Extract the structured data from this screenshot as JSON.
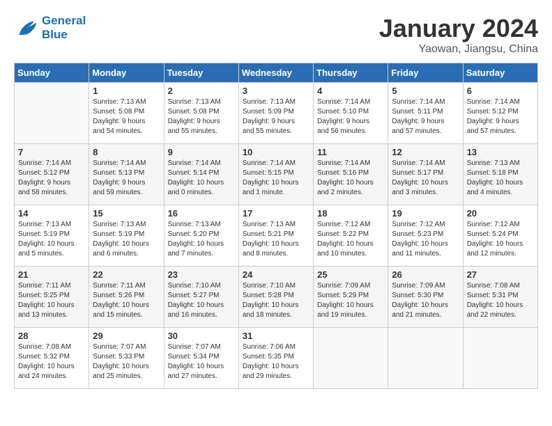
{
  "header": {
    "logo_line1": "General",
    "logo_line2": "Blue",
    "title": "January 2024",
    "subtitle": "Yaowan, Jiangsu, China"
  },
  "weekdays": [
    "Sunday",
    "Monday",
    "Tuesday",
    "Wednesday",
    "Thursday",
    "Friday",
    "Saturday"
  ],
  "weeks": [
    [
      {
        "day": "",
        "info": ""
      },
      {
        "day": "1",
        "info": "Sunrise: 7:13 AM\nSunset: 5:08 PM\nDaylight: 9 hours\nand 54 minutes."
      },
      {
        "day": "2",
        "info": "Sunrise: 7:13 AM\nSunset: 5:08 PM\nDaylight: 9 hours\nand 55 minutes."
      },
      {
        "day": "3",
        "info": "Sunrise: 7:13 AM\nSunset: 5:09 PM\nDaylight: 9 hours\nand 55 minutes."
      },
      {
        "day": "4",
        "info": "Sunrise: 7:14 AM\nSunset: 5:10 PM\nDaylight: 9 hours\nand 56 minutes."
      },
      {
        "day": "5",
        "info": "Sunrise: 7:14 AM\nSunset: 5:11 PM\nDaylight: 9 hours\nand 57 minutes."
      },
      {
        "day": "6",
        "info": "Sunrise: 7:14 AM\nSunset: 5:12 PM\nDaylight: 9 hours\nand 57 minutes."
      }
    ],
    [
      {
        "day": "7",
        "info": "Sunrise: 7:14 AM\nSunset: 5:12 PM\nDaylight: 9 hours\nand 58 minutes."
      },
      {
        "day": "8",
        "info": "Sunrise: 7:14 AM\nSunset: 5:13 PM\nDaylight: 9 hours\nand 59 minutes."
      },
      {
        "day": "9",
        "info": "Sunrise: 7:14 AM\nSunset: 5:14 PM\nDaylight: 10 hours\nand 0 minutes."
      },
      {
        "day": "10",
        "info": "Sunrise: 7:14 AM\nSunset: 5:15 PM\nDaylight: 10 hours\nand 1 minute."
      },
      {
        "day": "11",
        "info": "Sunrise: 7:14 AM\nSunset: 5:16 PM\nDaylight: 10 hours\nand 2 minutes."
      },
      {
        "day": "12",
        "info": "Sunrise: 7:14 AM\nSunset: 5:17 PM\nDaylight: 10 hours\nand 3 minutes."
      },
      {
        "day": "13",
        "info": "Sunrise: 7:13 AM\nSunset: 5:18 PM\nDaylight: 10 hours\nand 4 minutes."
      }
    ],
    [
      {
        "day": "14",
        "info": "Sunrise: 7:13 AM\nSunset: 5:19 PM\nDaylight: 10 hours\nand 5 minutes."
      },
      {
        "day": "15",
        "info": "Sunrise: 7:13 AM\nSunset: 5:19 PM\nDaylight: 10 hours\nand 6 minutes."
      },
      {
        "day": "16",
        "info": "Sunrise: 7:13 AM\nSunset: 5:20 PM\nDaylight: 10 hours\nand 7 minutes."
      },
      {
        "day": "17",
        "info": "Sunrise: 7:13 AM\nSunset: 5:21 PM\nDaylight: 10 hours\nand 8 minutes."
      },
      {
        "day": "18",
        "info": "Sunrise: 7:12 AM\nSunset: 5:22 PM\nDaylight: 10 hours\nand 10 minutes."
      },
      {
        "day": "19",
        "info": "Sunrise: 7:12 AM\nSunset: 5:23 PM\nDaylight: 10 hours\nand 11 minutes."
      },
      {
        "day": "20",
        "info": "Sunrise: 7:12 AM\nSunset: 5:24 PM\nDaylight: 10 hours\nand 12 minutes."
      }
    ],
    [
      {
        "day": "21",
        "info": "Sunrise: 7:11 AM\nSunset: 5:25 PM\nDaylight: 10 hours\nand 13 minutes."
      },
      {
        "day": "22",
        "info": "Sunrise: 7:11 AM\nSunset: 5:26 PM\nDaylight: 10 hours\nand 15 minutes."
      },
      {
        "day": "23",
        "info": "Sunrise: 7:10 AM\nSunset: 5:27 PM\nDaylight: 10 hours\nand 16 minutes."
      },
      {
        "day": "24",
        "info": "Sunrise: 7:10 AM\nSunset: 5:28 PM\nDaylight: 10 hours\nand 18 minutes."
      },
      {
        "day": "25",
        "info": "Sunrise: 7:09 AM\nSunset: 5:29 PM\nDaylight: 10 hours\nand 19 minutes."
      },
      {
        "day": "26",
        "info": "Sunrise: 7:09 AM\nSunset: 5:30 PM\nDaylight: 10 hours\nand 21 minutes."
      },
      {
        "day": "27",
        "info": "Sunrise: 7:08 AM\nSunset: 5:31 PM\nDaylight: 10 hours\nand 22 minutes."
      }
    ],
    [
      {
        "day": "28",
        "info": "Sunrise: 7:08 AM\nSunset: 5:32 PM\nDaylight: 10 hours\nand 24 minutes."
      },
      {
        "day": "29",
        "info": "Sunrise: 7:07 AM\nSunset: 5:33 PM\nDaylight: 10 hours\nand 25 minutes."
      },
      {
        "day": "30",
        "info": "Sunrise: 7:07 AM\nSunset: 5:34 PM\nDaylight: 10 hours\nand 27 minutes."
      },
      {
        "day": "31",
        "info": "Sunrise: 7:06 AM\nSunset: 5:35 PM\nDaylight: 10 hours\nand 29 minutes."
      },
      {
        "day": "",
        "info": ""
      },
      {
        "day": "",
        "info": ""
      },
      {
        "day": "",
        "info": ""
      }
    ]
  ]
}
